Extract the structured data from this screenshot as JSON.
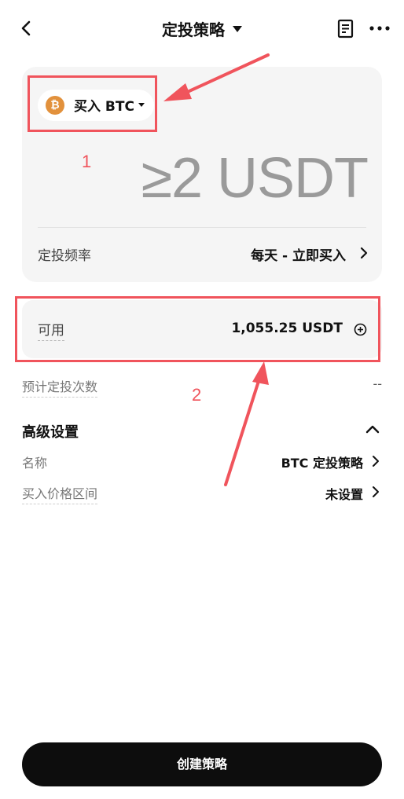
{
  "header": {
    "title": "定投策略",
    "back_icon": "chevron-left-icon",
    "doc_icon": "document-icon",
    "more_icon": "more-dots-icon"
  },
  "strategy": {
    "coin_symbol": "₿",
    "coin_label": "买入 BTC",
    "amount_placeholder": "≥2 USDT",
    "frequency_label": "定投频率",
    "frequency_value": "每天 - 立即买入"
  },
  "available": {
    "label": "可用",
    "value": "1,055.25 USDT"
  },
  "estimated": {
    "label": "预计定投次数",
    "value": "--"
  },
  "advanced": {
    "title": "高级设置",
    "name_label": "名称",
    "name_value": "BTC 定投策略",
    "range_label": "买入价格区间",
    "range_value": "未设置"
  },
  "create_button_label": "创建策略",
  "annotations": {
    "label_1": "1",
    "label_2": "2",
    "color": "#f0545c"
  },
  "colors": {
    "coin": "#e2913c",
    "button": "#0d0d0d",
    "card": "#f5f5f5"
  }
}
